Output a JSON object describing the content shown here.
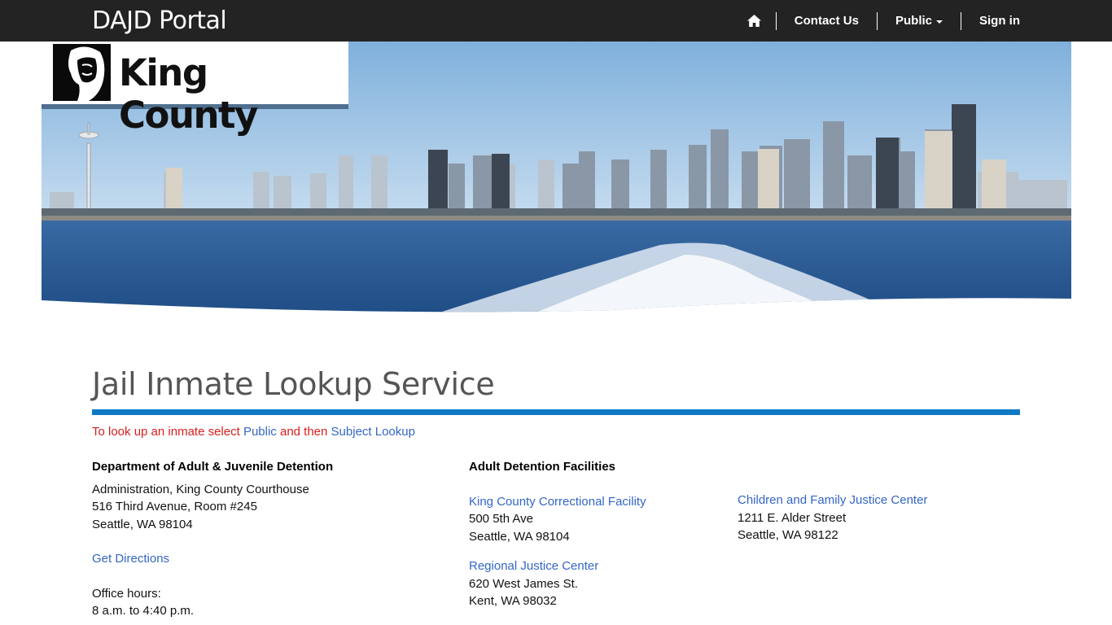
{
  "navbar": {
    "brand": "DAJD Portal",
    "home_icon": "home-icon",
    "items": [
      {
        "label": "Contact Us"
      },
      {
        "label": "Public"
      },
      {
        "label": "Sign in"
      }
    ]
  },
  "banner": {
    "logo_text": "King County",
    "colors": {
      "sky": "#8fb8de",
      "water": "#2b5c96",
      "logo_border": "#4f6f8f"
    }
  },
  "main": {
    "title": "Jail Inmate Lookup Service",
    "instructions": {
      "prefix": "To look up an inmate select ",
      "link1": "Public",
      "middle": " and then ",
      "link2": "Subject Lookup"
    },
    "department": {
      "heading": "Department of Adult & Juvenile Detention",
      "address": [
        "Administration, King County Courthouse",
        "516 Third Avenue, Room #245",
        "Seattle, WA 98104"
      ],
      "directions_link": "Get Directions",
      "hours_label": "Office hours:",
      "hours": "8 a.m. to 4:40 p.m."
    },
    "facilities": {
      "heading": "Adult Detention Facilities",
      "list": [
        {
          "name": "King County Correctional Facility",
          "address": [
            "500 5th Ave",
            "Seattle, WA 98104"
          ]
        },
        {
          "name": "Regional Justice Center",
          "address": [
            "620 West James St.",
            "Kent, WA 98032"
          ]
        },
        {
          "name": "Children and Family Justice Center",
          "address": [
            "1211 E. Alder Street",
            "Seattle, WA 98122"
          ]
        }
      ]
    }
  },
  "colors": {
    "navbar_bg": "#232323",
    "accent_rule": "#0f7ac4",
    "link": "#3466c5",
    "instruction_text": "#d81e1e"
  }
}
